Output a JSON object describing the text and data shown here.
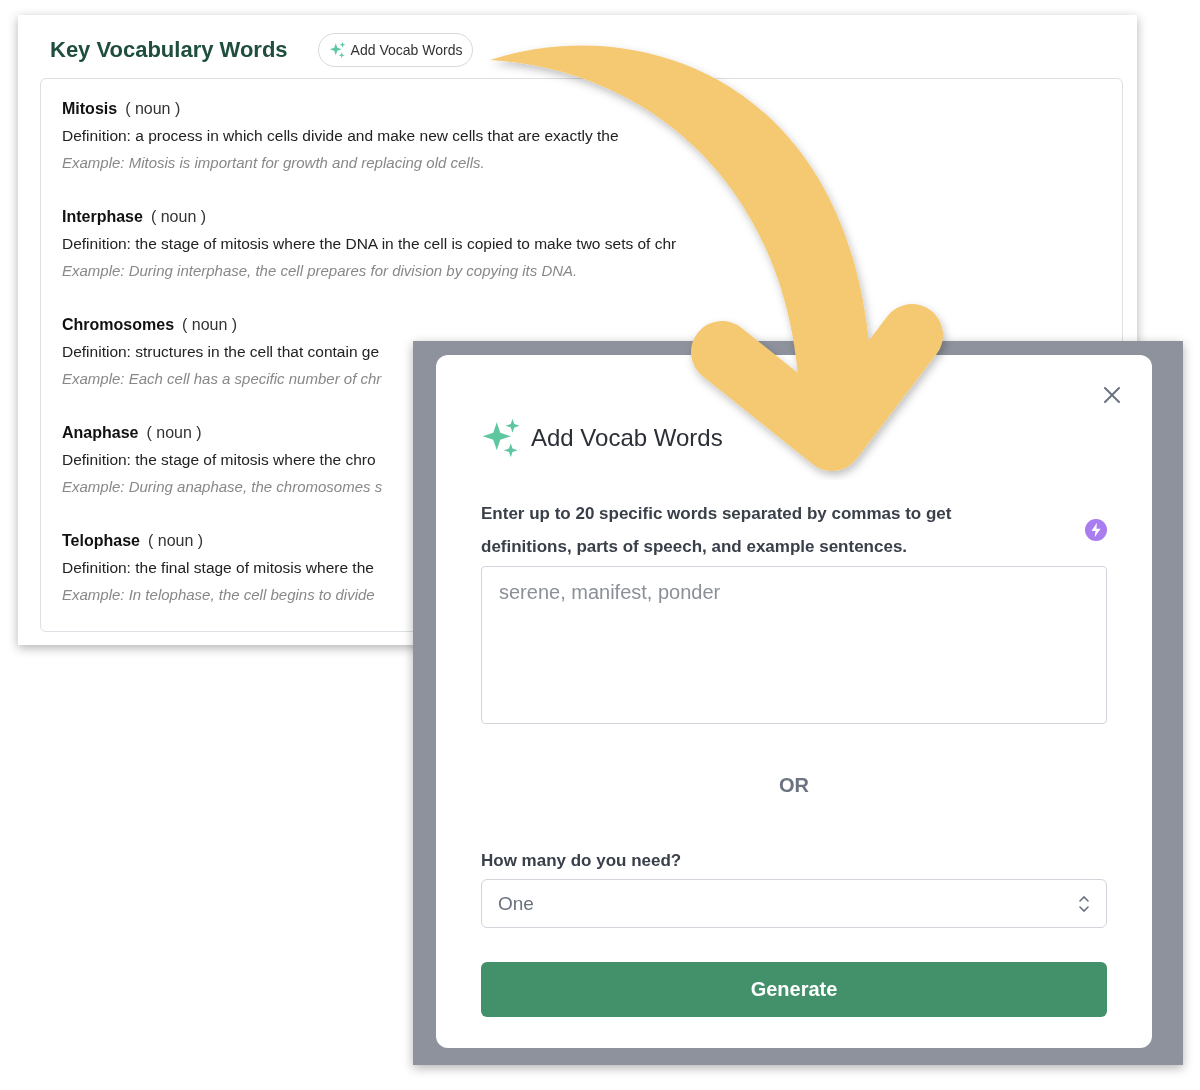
{
  "vocab_panel": {
    "title": "Key Vocabulary Words",
    "add_button": "Add Vocab Words",
    "entries": [
      {
        "word": "Mitosis",
        "part_of_speech": "( noun )",
        "definition": "Definition: a process in which cells divide and make new cells that are exactly the",
        "example": "Example: Mitosis is important for growth and replacing old cells."
      },
      {
        "word": "Interphase",
        "part_of_speech": "( noun )",
        "definition": "Definition: the stage of mitosis where the DNA in the cell is copied to make two sets of chr",
        "example": "Example: During interphase, the cell prepares for division by copying its DNA."
      },
      {
        "word": "Chromosomes",
        "part_of_speech": "( noun )",
        "definition": "Definition: structures in the cell that contain ge",
        "example": "Example: Each cell has a specific number of chr"
      },
      {
        "word": "Anaphase",
        "part_of_speech": "( noun )",
        "definition": "Definition: the stage of mitosis where the chro",
        "example": "Example: During anaphase, the chromosomes s"
      },
      {
        "word": "Telophase",
        "part_of_speech": "( noun )",
        "definition": "Definition: the final stage of mitosis where the",
        "example": "Example: In telophase, the cell begins to divide"
      }
    ]
  },
  "modal": {
    "title": "Add Vocab Words",
    "description": "Enter up to 20 specific words separated by commas to get definitions, parts of speech, and example sentences.",
    "placeholder": "serene, manifest, ponder",
    "divider": "OR",
    "count_label": "How many do you need?",
    "count_value": "One",
    "button": "Generate"
  }
}
